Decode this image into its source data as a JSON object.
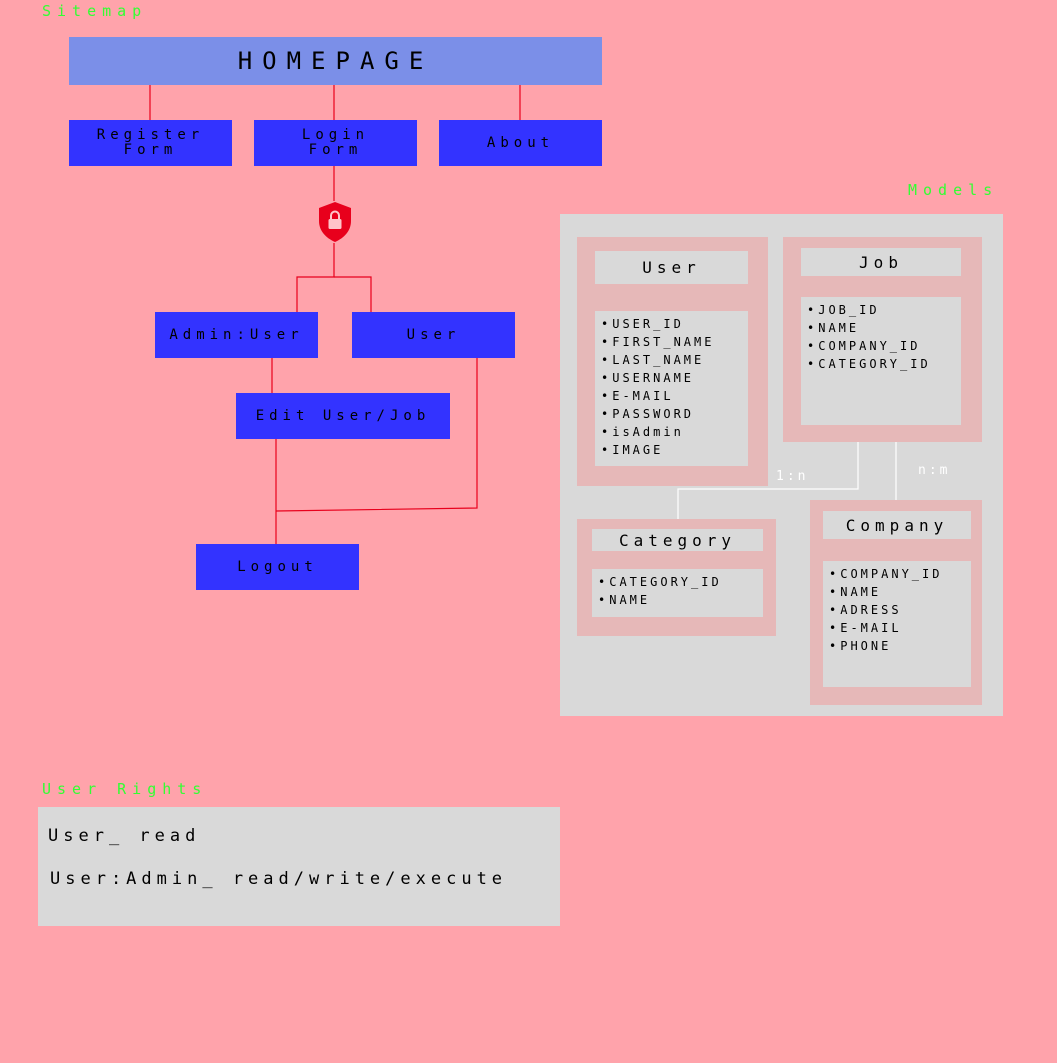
{
  "sitemap": {
    "title": "Sitemap",
    "homepage": "HOMEPAGE",
    "register": "Register\nForm",
    "login": "Login\nForm",
    "about": "About",
    "admin_user": "Admin:User",
    "user": "User",
    "edit": "Edit User/Job",
    "logout": "Logout"
  },
  "models": {
    "title": "Models",
    "user": {
      "title": "User",
      "fields": [
        "USER_ID",
        "FIRST_NAME",
        "LAST_NAME",
        "USERNAME",
        "E-MAIL",
        "PASSWORD",
        "isAdmin",
        "IMAGE"
      ]
    },
    "job": {
      "title": "Job",
      "fields": [
        "JOB_ID",
        "NAME",
        "COMPANY_ID",
        "CATEGORY_ID"
      ]
    },
    "category": {
      "title": "Category",
      "fields": [
        "CATEGORY_ID",
        "NAME"
      ]
    },
    "company": {
      "title": "Company",
      "fields": [
        "COMPANY_ID",
        "NAME",
        "ADRESS",
        "E-MAIL",
        "PHONE"
      ]
    },
    "rel_one_n": "1:n",
    "rel_n_m": "n:m"
  },
  "rights": {
    "title": "User Rights",
    "line1": "User_ read",
    "line2": "User:Admin_ read/write/execute"
  },
  "colors": {
    "background": "#ffa3ab",
    "node": "#3333ff",
    "homepage": "#7b8fe8",
    "heading": "#33ff33",
    "wire": "#e8001c",
    "panel": "#d9d9d9",
    "card": "#e6b8b8"
  }
}
